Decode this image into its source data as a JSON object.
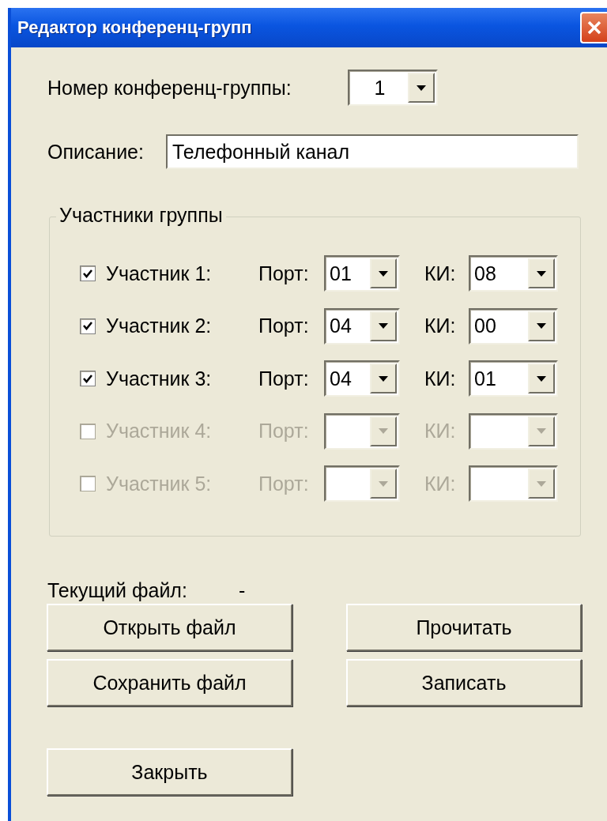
{
  "window": {
    "title": "Редактор конференц-групп"
  },
  "group_number": {
    "label": "Номер конференц-группы:",
    "value": "1"
  },
  "description": {
    "label": "Описание:",
    "value": "Телефонный канал"
  },
  "participants_group": {
    "title": "Участники группы"
  },
  "participants": [
    {
      "label": "Участник 1:",
      "checked": true,
      "disabled": false,
      "port_label": "Порт:",
      "port": "01",
      "ki_label": "КИ:",
      "ki": "08"
    },
    {
      "label": "Участник 2:",
      "checked": true,
      "disabled": false,
      "port_label": "Порт:",
      "port": "04",
      "ki_label": "КИ:",
      "ki": "00"
    },
    {
      "label": "Участник 3:",
      "checked": true,
      "disabled": false,
      "port_label": "Порт:",
      "port": "04",
      "ki_label": "КИ:",
      "ki": "01"
    },
    {
      "label": "Участник 4:",
      "checked": false,
      "disabled": true,
      "port_label": "Порт:",
      "ki_label": "КИ:"
    },
    {
      "label": "Участник 5:",
      "checked": false,
      "disabled": true,
      "port_label": "Порт:",
      "ki_label": "КИ:"
    }
  ],
  "current_file": {
    "label": "Текущий файл:",
    "value": "-"
  },
  "buttons": [
    [
      "Открыть файл",
      "Прочитать"
    ],
    [
      "Сохранить файл",
      "Записать"
    ]
  ],
  "close_button": "Закрыть"
}
